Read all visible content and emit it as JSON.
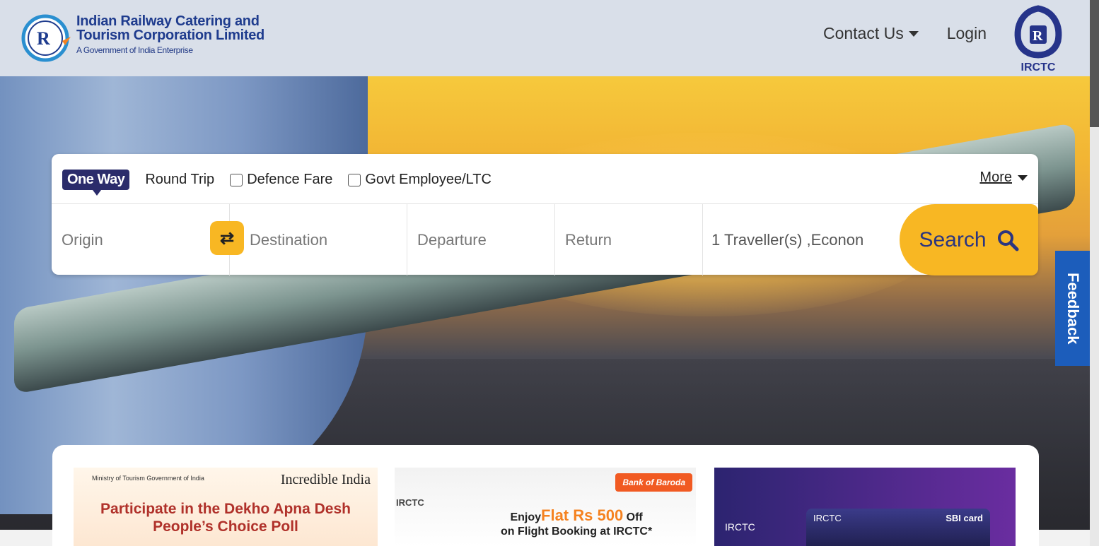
{
  "header": {
    "brand_line1": "Indian Railway Catering and",
    "brand_line2": "Tourism Corporation Limited",
    "brand_sub": "A Government of India Enterprise",
    "contact_label": "Contact Us",
    "login_label": "Login",
    "irctc_logo_text": "IRCTC"
  },
  "search": {
    "one_way": "One Way",
    "round_trip": "Round Trip",
    "defence_fare": "Defence Fare",
    "govt_employee": "Govt Employee/LTC",
    "more_label": "More",
    "origin_placeholder": "Origin",
    "destination_placeholder": "Destination",
    "departure_placeholder": "Departure",
    "return_placeholder": "Return",
    "travellers": "1 Traveller(s) ,Econon",
    "search_label": "Search",
    "swap_icon": "swap-icon"
  },
  "feedback_label": "Feedback",
  "promos": {
    "b1_ministry": "Ministry of Tourism Government of India",
    "b1_brand": "Incredible India",
    "b1_title_line1": "Participate in the Dekho Apna Desh",
    "b1_title_line2": "People’s Choice Poll",
    "b2_irctc": "IRCTC",
    "b2_bank": "Bank of Baroda",
    "b2_enjoy": "Enjoy",
    "b2_flat": "Flat Rs 500",
    "b2_off": "Off",
    "b2_on": "on Flight Booking at IRCTC*",
    "b3_irctc": "IRCTC",
    "b3_card_left": "IRCTC",
    "b3_card_right": "SBI card"
  },
  "colors": {
    "header_bg": "#d9dfe9",
    "brand_blue": "#1f3c8e",
    "accent_yellow": "#f8b723",
    "one_way_bg": "#2b2c6b",
    "feedback_bg": "#1c5dbb"
  }
}
